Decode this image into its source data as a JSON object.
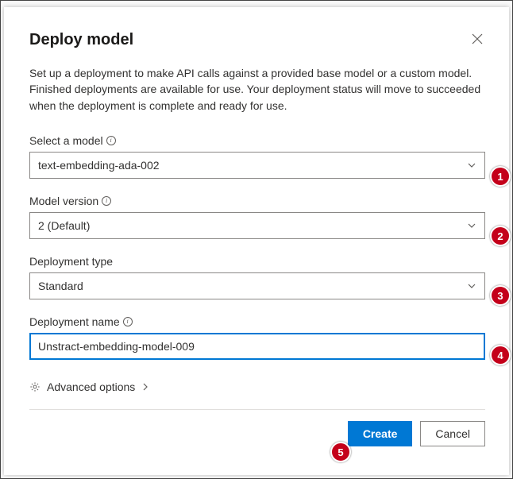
{
  "header": {
    "title": "Deploy model"
  },
  "description": "Set up a deployment to make API calls against a provided base model or a custom model. Finished deployments are available for use. Your deployment status will move to succeeded when the deployment is complete and ready for use.",
  "fields": {
    "model": {
      "label": "Select a model",
      "value": "text-embedding-ada-002"
    },
    "version": {
      "label": "Model version",
      "value": "2 (Default)"
    },
    "deploy_type": {
      "label": "Deployment type",
      "value": "Standard"
    },
    "deploy_name": {
      "label": "Deployment name",
      "value": "Unstract-embedding-model-009"
    }
  },
  "advanced": {
    "label": "Advanced options"
  },
  "footer": {
    "create": "Create",
    "cancel": "Cancel"
  },
  "badges": {
    "b1": "1",
    "b2": "2",
    "b3": "3",
    "b4": "4",
    "b5": "5"
  }
}
